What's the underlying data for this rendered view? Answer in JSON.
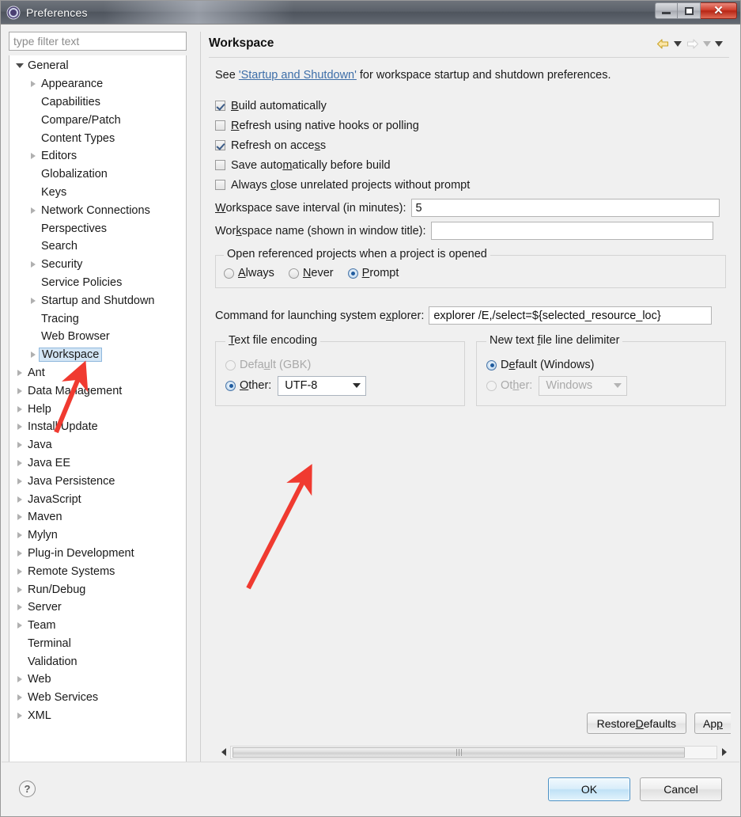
{
  "window": {
    "title": "Preferences",
    "icon": "eclipse-preferences-icon",
    "minimize_label": "",
    "maximize_label": "",
    "close_label": "✕"
  },
  "sidebar": {
    "filter_placeholder": "type filter text",
    "filter_value": "",
    "items": [
      {
        "label": "General",
        "depth": 0,
        "twisty": "down",
        "selected": false
      },
      {
        "label": "Appearance",
        "depth": 1,
        "twisty": "right",
        "selected": false
      },
      {
        "label": "Capabilities",
        "depth": 1,
        "twisty": "none",
        "selected": false
      },
      {
        "label": "Compare/Patch",
        "depth": 1,
        "twisty": "none",
        "selected": false
      },
      {
        "label": "Content Types",
        "depth": 1,
        "twisty": "none",
        "selected": false
      },
      {
        "label": "Editors",
        "depth": 1,
        "twisty": "right",
        "selected": false
      },
      {
        "label": "Globalization",
        "depth": 1,
        "twisty": "none",
        "selected": false
      },
      {
        "label": "Keys",
        "depth": 1,
        "twisty": "none",
        "selected": false
      },
      {
        "label": "Network Connections",
        "depth": 1,
        "twisty": "right",
        "selected": false
      },
      {
        "label": "Perspectives",
        "depth": 1,
        "twisty": "none",
        "selected": false
      },
      {
        "label": "Search",
        "depth": 1,
        "twisty": "none",
        "selected": false
      },
      {
        "label": "Security",
        "depth": 1,
        "twisty": "right",
        "selected": false
      },
      {
        "label": "Service Policies",
        "depth": 1,
        "twisty": "none",
        "selected": false
      },
      {
        "label": "Startup and Shutdown",
        "depth": 1,
        "twisty": "right",
        "selected": false
      },
      {
        "label": "Tracing",
        "depth": 1,
        "twisty": "none",
        "selected": false
      },
      {
        "label": "Web Browser",
        "depth": 1,
        "twisty": "none",
        "selected": false
      },
      {
        "label": "Workspace",
        "depth": 1,
        "twisty": "right",
        "selected": true
      },
      {
        "label": "Ant",
        "depth": 0,
        "twisty": "right",
        "selected": false
      },
      {
        "label": "Data Management",
        "depth": 0,
        "twisty": "right",
        "selected": false
      },
      {
        "label": "Help",
        "depth": 0,
        "twisty": "right",
        "selected": false
      },
      {
        "label": "Install/Update",
        "depth": 0,
        "twisty": "right",
        "selected": false
      },
      {
        "label": "Java",
        "depth": 0,
        "twisty": "right",
        "selected": false
      },
      {
        "label": "Java EE",
        "depth": 0,
        "twisty": "right",
        "selected": false
      },
      {
        "label": "Java Persistence",
        "depth": 0,
        "twisty": "right",
        "selected": false
      },
      {
        "label": "JavaScript",
        "depth": 0,
        "twisty": "right",
        "selected": false
      },
      {
        "label": "Maven",
        "depth": 0,
        "twisty": "right",
        "selected": false
      },
      {
        "label": "Mylyn",
        "depth": 0,
        "twisty": "right",
        "selected": false
      },
      {
        "label": "Plug-in Development",
        "depth": 0,
        "twisty": "right",
        "selected": false
      },
      {
        "label": "Remote Systems",
        "depth": 0,
        "twisty": "right",
        "selected": false
      },
      {
        "label": "Run/Debug",
        "depth": 0,
        "twisty": "right",
        "selected": false
      },
      {
        "label": "Server",
        "depth": 0,
        "twisty": "right",
        "selected": false
      },
      {
        "label": "Team",
        "depth": 0,
        "twisty": "right",
        "selected": false
      },
      {
        "label": "Terminal",
        "depth": 0,
        "twisty": "none",
        "selected": false
      },
      {
        "label": "Validation",
        "depth": 0,
        "twisty": "none",
        "selected": false
      },
      {
        "label": "Web",
        "depth": 0,
        "twisty": "right",
        "selected": false
      },
      {
        "label": "Web Services",
        "depth": 0,
        "twisty": "right",
        "selected": false
      },
      {
        "label": "XML",
        "depth": 0,
        "twisty": "right",
        "selected": false
      }
    ]
  },
  "page": {
    "title": "Workspace",
    "nav": {
      "back_icon": "back-arrow-icon",
      "back_menu_icon": "chevron-down-icon",
      "forward_icon": "forward-arrow-icon",
      "forward_menu_icon": "chevron-down-icon",
      "view_menu_icon": "chevron-down-icon"
    },
    "see_prefix": "See ",
    "see_link": "'Startup and Shutdown'",
    "see_suffix": " for workspace startup and shutdown preferences.",
    "checkboxes": [
      {
        "label_pre": "",
        "mnemonic": "B",
        "label_post": "uild automatically",
        "checked": true
      },
      {
        "label_pre": "",
        "mnemonic": "R",
        "label_post": "efresh using native hooks or polling",
        "checked": false
      },
      {
        "label_pre": "Refresh on acce",
        "mnemonic": "s",
        "label_post": "s",
        "checked": true
      },
      {
        "label_pre": "Save auto",
        "mnemonic": "m",
        "label_post": "atically before build",
        "checked": false
      },
      {
        "label_pre": "Always ",
        "mnemonic": "c",
        "label_post": "lose unrelated projects without prompt",
        "checked": false
      }
    ],
    "save_interval": {
      "label_pre": "",
      "mnemonic": "W",
      "label_post": "orkspace save interval (in minutes):",
      "value": "5"
    },
    "workspace_name": {
      "label_pre": "Wor",
      "mnemonic": "k",
      "label_post": "space name (shown in window title):",
      "value": "",
      "placeholder": ""
    },
    "open_referenced": {
      "legend": "Open referenced projects when a project is opened",
      "options": [
        {
          "label_pre": "",
          "mnemonic": "A",
          "label_post": "lways",
          "selected": false
        },
        {
          "label_pre": "",
          "mnemonic": "N",
          "label_post": "ever",
          "selected": false
        },
        {
          "label_pre": "",
          "mnemonic": "P",
          "label_post": "rompt",
          "selected": true
        }
      ]
    },
    "explorer_command": {
      "label_pre": "Command for launching system e",
      "mnemonic": "x",
      "label_post": "plorer:",
      "value": "explorer /E,/select=${selected_resource_loc}"
    },
    "text_file_encoding": {
      "legend_pre": "",
      "legend_mnemonic": "T",
      "legend_post": "ext file encoding",
      "default_option": {
        "label_pre": "Defa",
        "mnemonic": "u",
        "label_post": "lt (GBK)",
        "selected": false
      },
      "other_option": {
        "label_pre": "",
        "mnemonic": "O",
        "label_post": "ther:",
        "selected": true
      },
      "combo_value": "UTF-8",
      "combo_icon": "chevron-down-icon"
    },
    "line_delimiter": {
      "legend_pre": "New text ",
      "legend_mnemonic": "f",
      "legend_post": "ile line delimiter",
      "default_option": {
        "label_pre": "D",
        "mnemonic": "e",
        "label_post": "fault (Windows)",
        "selected": true
      },
      "other_option": {
        "label_pre": "Ot",
        "mnemonic": "h",
        "label_post": "er:",
        "selected": false,
        "disabled": true
      },
      "combo_value": "Windows",
      "combo_icon": "chevron-down-icon",
      "combo_disabled": true
    },
    "restore_defaults_label_pre": "Restore ",
    "restore_defaults_mnemonic": "D",
    "restore_defaults_label_post": "efaults",
    "apply_label_pre": "Ap",
    "apply_mnemonic": "p",
    "apply_label_post": "",
    "scrollbar": {
      "left_icon": "scroll-left-arrow-icon",
      "right_icon": "scroll-right-arrow-icon",
      "grip_icon": "scroll-grip-icon"
    }
  },
  "footer": {
    "help_label": "?",
    "ok_label": "OK",
    "cancel_label": "Cancel"
  },
  "annotations": {
    "arrow_color": "#f03a30",
    "arrow_1_target": "Workspace tree item",
    "arrow_2_target": "UTF-8 encoding combo box"
  }
}
